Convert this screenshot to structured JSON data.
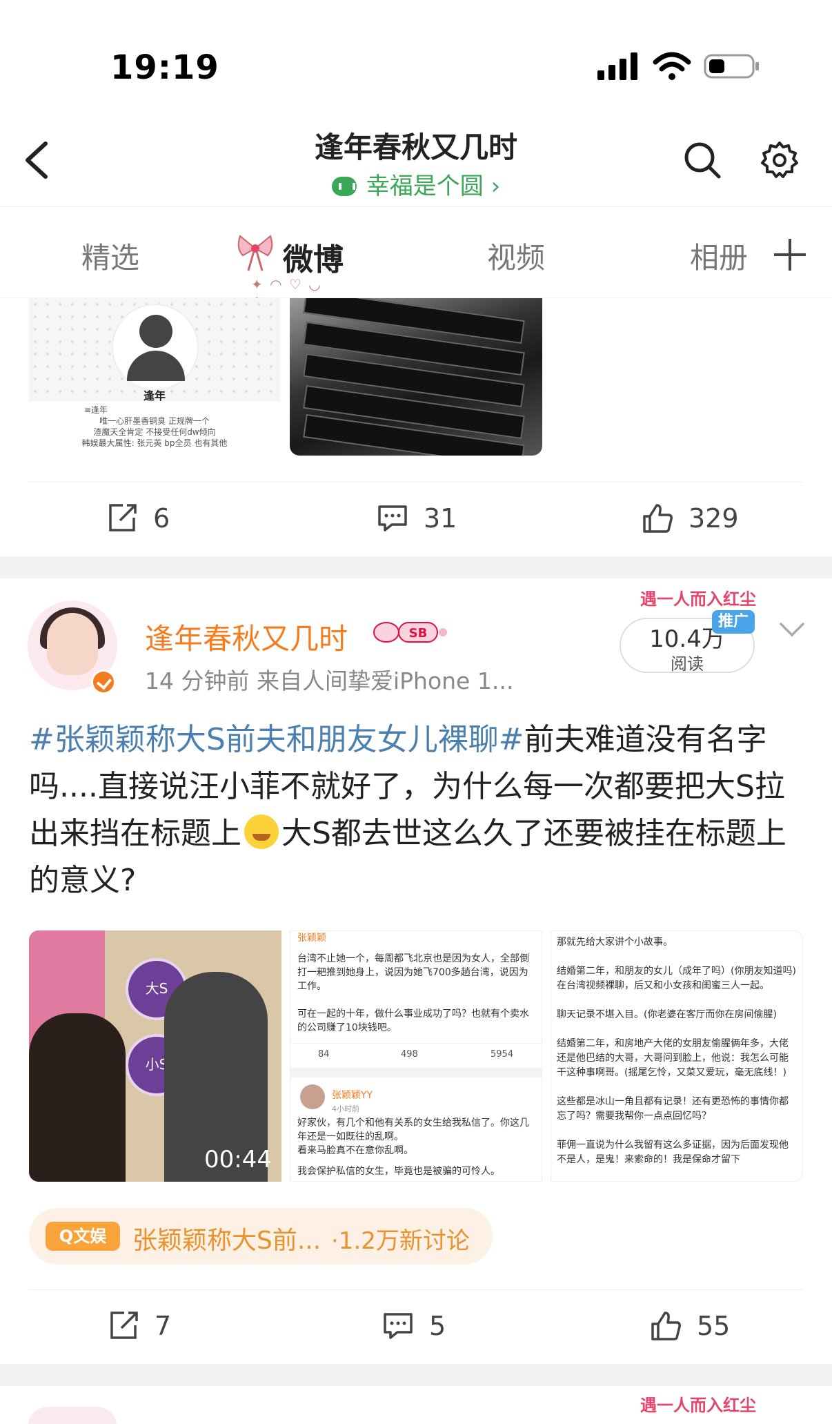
{
  "status_bar": {
    "time": "19:19"
  },
  "header": {
    "title": "逢年春秋又几时",
    "subtitle": "幸福是个圆 ›"
  },
  "tabs": [
    {
      "label": "精选",
      "active": false
    },
    {
      "label": "微博",
      "active": true
    },
    {
      "label": "视频",
      "active": false
    },
    {
      "label": "相册",
      "active": false
    }
  ],
  "post1": {
    "image1": {
      "name": "逢年",
      "lines": [
        "≡逢年",
        "唯一心肝墨香铜臭 正规牌一个",
        "渣魔天全肯定 不接受任何dw倾向",
        "韩娱最大属性: 张元英 bp全员 也有其他"
      ]
    },
    "actions": {
      "repost": "6",
      "comment": "31",
      "like": "329"
    }
  },
  "post2": {
    "author": "逢年春秋又几时",
    "meta": "14 分钟前   来自人间挚爱iPhone 1...",
    "promo_banner": "遇一人而入红尘",
    "read_count": "10.4万",
    "read_label": "阅读",
    "promo_tag": "推广",
    "body": {
      "hashtag": "#张颖颖称大S前夫和朋友女儿裸聊#",
      "text1": "前夫难道没有名字吗....直接说汪小菲不就好了，为什么每一次都要把大S拉出来挡在标题上",
      "text2": "大S都去世这么久了还要被挂在标题上的意义?"
    },
    "video": {
      "duration": "00:44",
      "clock1": "大S",
      "clock2": "小S"
    },
    "screenshot2": {
      "author_top": "张颖颖",
      "text1": "台湾不止她一个，每周都飞北京也是因为女人，全部倒打一耙推到她身上，说因为她飞700多趟台湾，说因为工作。",
      "text2": "可在一起的十年，做什么事业成功了吗？也就有个卖水的公司赚了10块钱吧。",
      "stats": [
        "84",
        "498",
        "5954"
      ],
      "author2": "张颖颖YY",
      "time2": "4小时前",
      "text3": "好家伙，有几个和他有关系的女生给我私信了。你这几年还是一如既往的乱啊。",
      "text4": "看来马脸真不在意你乱啊。",
      "text5": "我会保护私信的女生，毕竟也是被骗的可怜人。"
    },
    "screenshot3": {
      "p1": "那就先给大家讲个小故事。",
      "p2": "结婚第二年，和朋友的女儿（成年了吗）(你朋友知道吗) 在台湾视频裸聊，后又和小女孩和闺蜜三人一起。",
      "p3": "聊天记录不堪入目。(你老婆在客厅而你在房间偷腥)",
      "p4": "结婚第二年，和房地产大佬的女朋友偷腥俩年多，大佬还是他巴结的大哥，大哥问到脸上，他说：我怎么可能干这种事啊哥。(摇尾乞怜，又菜又爱玩，毫无底线！)",
      "p5": "这些都是冰山一角且都有记录！还有更恐怖的事情你都忘了吗？需要我帮你一点点回忆吗？",
      "p6": "菲佣一直说为什么我留有这么多证据，因为后面发现他不是人，是鬼！来索命的！我是保命才留下"
    },
    "topic": {
      "tag": "Q文娱",
      "title": "张颖颖称大S前...",
      "count": "·1.2万新讨论"
    },
    "actions": {
      "repost": "7",
      "comment": "5",
      "like": "55"
    }
  },
  "post3": {
    "promo_banner": "遇一人而入红尘"
  },
  "colors": {
    "accent_orange": "#f57b1f",
    "hashtag_blue": "#4a7fb0",
    "green": "#3aa757"
  }
}
